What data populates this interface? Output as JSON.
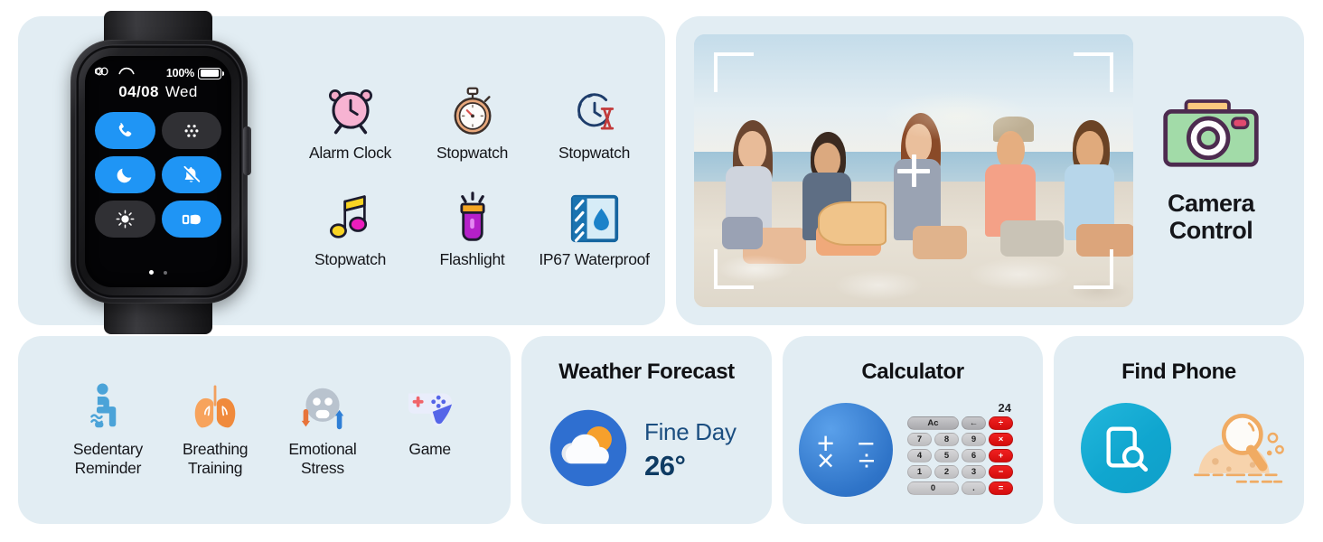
{
  "watch": {
    "status": {
      "link_icon": "link-chain-icon",
      "call_icon": "phone-handset-icon",
      "battery_percent": "100%",
      "battery_icon": "battery-full-icon"
    },
    "date": "04/08",
    "weekday": "Wed",
    "tiles": [
      {
        "name": "phone-tile",
        "icon": "phone-icon",
        "state": "on"
      },
      {
        "name": "apps-tile",
        "icon": "app-grid-icon",
        "state": "off"
      },
      {
        "name": "sleep-tile",
        "icon": "moon-icon",
        "state": "on"
      },
      {
        "name": "mute-tile",
        "icon": "bell-muted-icon",
        "state": "on"
      },
      {
        "name": "brightness-tile",
        "icon": "sun-icon",
        "state": "off"
      },
      {
        "name": "wrist-raise-tile",
        "icon": "wrist-hand-icon",
        "state": "on"
      }
    ],
    "page_dots": 2,
    "active_dot": 1
  },
  "features": [
    {
      "label": "Alarm Clock",
      "icon": "alarm-clock-icon"
    },
    {
      "label": "Stopwatch",
      "icon": "stopwatch-icon"
    },
    {
      "label": "Stopwatch",
      "icon": "clock-hourglass-icon"
    },
    {
      "label": "Stopwatch",
      "icon": "music-note-icon"
    },
    {
      "label": "Flashlight",
      "icon": "flashlight-icon"
    },
    {
      "label": "IP67 Waterproof",
      "icon": "waterproof-icon"
    }
  ],
  "camera": {
    "photo_alt": "friends-on-beach-photo",
    "viewfinder_icon": "viewfinder-crosshair-icon",
    "icon": "camera-icon",
    "label_line1": "Camera",
    "label_line2": "Control"
  },
  "health": [
    {
      "label_line1": "Sedentary",
      "label_line2": "Reminder",
      "icon": "sitting-person-icon"
    },
    {
      "label_line1": "Breathing",
      "label_line2": "Training",
      "icon": "lungs-icon"
    },
    {
      "label_line1": "Emotional",
      "label_line2": "Stress",
      "icon": "stress-face-icon"
    },
    {
      "label_line1": "Game",
      "label_line2": "",
      "icon": "gamepad-icon"
    }
  ],
  "weather": {
    "title": "Weather Forecast",
    "icon": "sun-cloud-icon",
    "condition": "Fine Day",
    "temperature": "26°"
  },
  "calculator": {
    "title": "Calculator",
    "icon": "math-operators-icon",
    "display": "24",
    "keys": [
      [
        {
          "label": "Ac",
          "type": "wide dark"
        },
        {
          "label": "←",
          "type": "num dark"
        },
        {
          "label": "÷",
          "type": "op"
        }
      ],
      [
        {
          "label": "7",
          "type": "num"
        },
        {
          "label": "8",
          "type": "num"
        },
        {
          "label": "9",
          "type": "num"
        },
        {
          "label": "×",
          "type": "op"
        }
      ],
      [
        {
          "label": "4",
          "type": "num"
        },
        {
          "label": "5",
          "type": "num"
        },
        {
          "label": "6",
          "type": "num"
        },
        {
          "label": "+",
          "type": "op"
        }
      ],
      [
        {
          "label": "1",
          "type": "num"
        },
        {
          "label": "2",
          "type": "num"
        },
        {
          "label": "3",
          "type": "num"
        },
        {
          "label": "−",
          "type": "op"
        }
      ],
      [
        {
          "label": "0",
          "type": "wide"
        },
        {
          "label": ".",
          "type": "num"
        },
        {
          "label": "=",
          "type": "op"
        }
      ]
    ],
    "circle_symbols": [
      "+",
      "−",
      "×",
      "÷"
    ]
  },
  "find_phone": {
    "title": "Find Phone",
    "icon": "phone-search-icon",
    "illustration": "magnifier-sand-icon"
  },
  "colors": {
    "panel_bg": "#e2edf3",
    "accent_blue": "#1f95f5",
    "calc_red": "#e01414",
    "find_cyan": "#13a8d0",
    "weather_blue": "#2f74c8",
    "text_dark": "#15161a"
  }
}
